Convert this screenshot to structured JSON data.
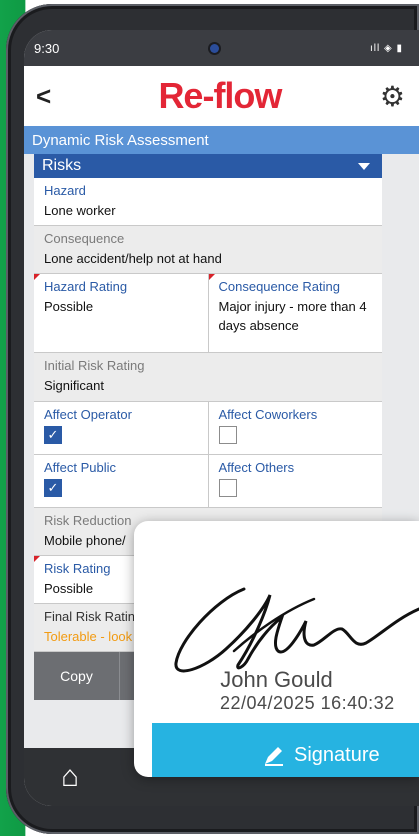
{
  "status": {
    "time": "9:30",
    "icons": "ıll ◈ ▮"
  },
  "appbar": {
    "back": "<",
    "logo": "Re-flow",
    "settings_icon": "gear-icon"
  },
  "subheader": "Dynamic Risk Assessment",
  "section": "Risks",
  "fields": {
    "hazard": {
      "label": "Hazard",
      "value": "Lone worker"
    },
    "consequence": {
      "label": "Consequence",
      "value": "Lone accident/help not at hand"
    },
    "hazard_rating": {
      "label": "Hazard Rating",
      "value": "Possible"
    },
    "consequence_rating": {
      "label": "Consequence Rating",
      "value": "Major injury - more than 4 days absence"
    },
    "initial_risk": {
      "label": "Initial Risk Rating",
      "value": "Significant"
    },
    "affect_operator": {
      "label": "Affect Operator",
      "checked": true
    },
    "affect_coworkers": {
      "label": "Affect Coworkers",
      "checked": false
    },
    "affect_public": {
      "label": "Affect Public",
      "checked": true
    },
    "affect_others": {
      "label": "Affect Others",
      "checked": false
    },
    "risk_reduction": {
      "label": "Risk Reduction",
      "value": "Mobile phone/"
    },
    "risk_rating": {
      "label": "Risk Rating",
      "value": "Possible"
    },
    "final_risk": {
      "label": "Final Risk Ratin",
      "value": "Tolerable - look"
    }
  },
  "buttons": {
    "copy": "Copy"
  },
  "signature": {
    "name": "John Gould",
    "datetime": "22/04/2025 16:40:32",
    "button": "Signature"
  }
}
